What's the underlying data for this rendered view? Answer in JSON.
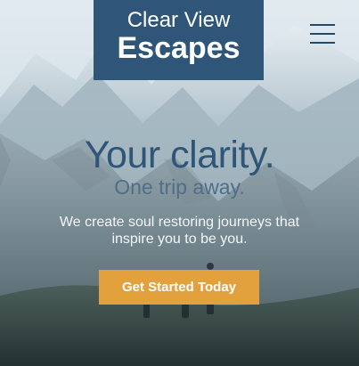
{
  "header": {
    "logo_line_1": "Clear View",
    "logo_line_2": "Escapes",
    "menu_icon": "hamburger-menu-icon"
  },
  "hero": {
    "headline": "Your clarity.",
    "subheadline": "One trip away.",
    "description": "We create soul restoring journeys that inspire you to be you.",
    "cta_label": "Get Started Today"
  },
  "colors": {
    "logo_background": "#2f5678",
    "headline": "#2f5678",
    "subheadline": "#4f6f89",
    "cta_background": "#e2a13d"
  }
}
